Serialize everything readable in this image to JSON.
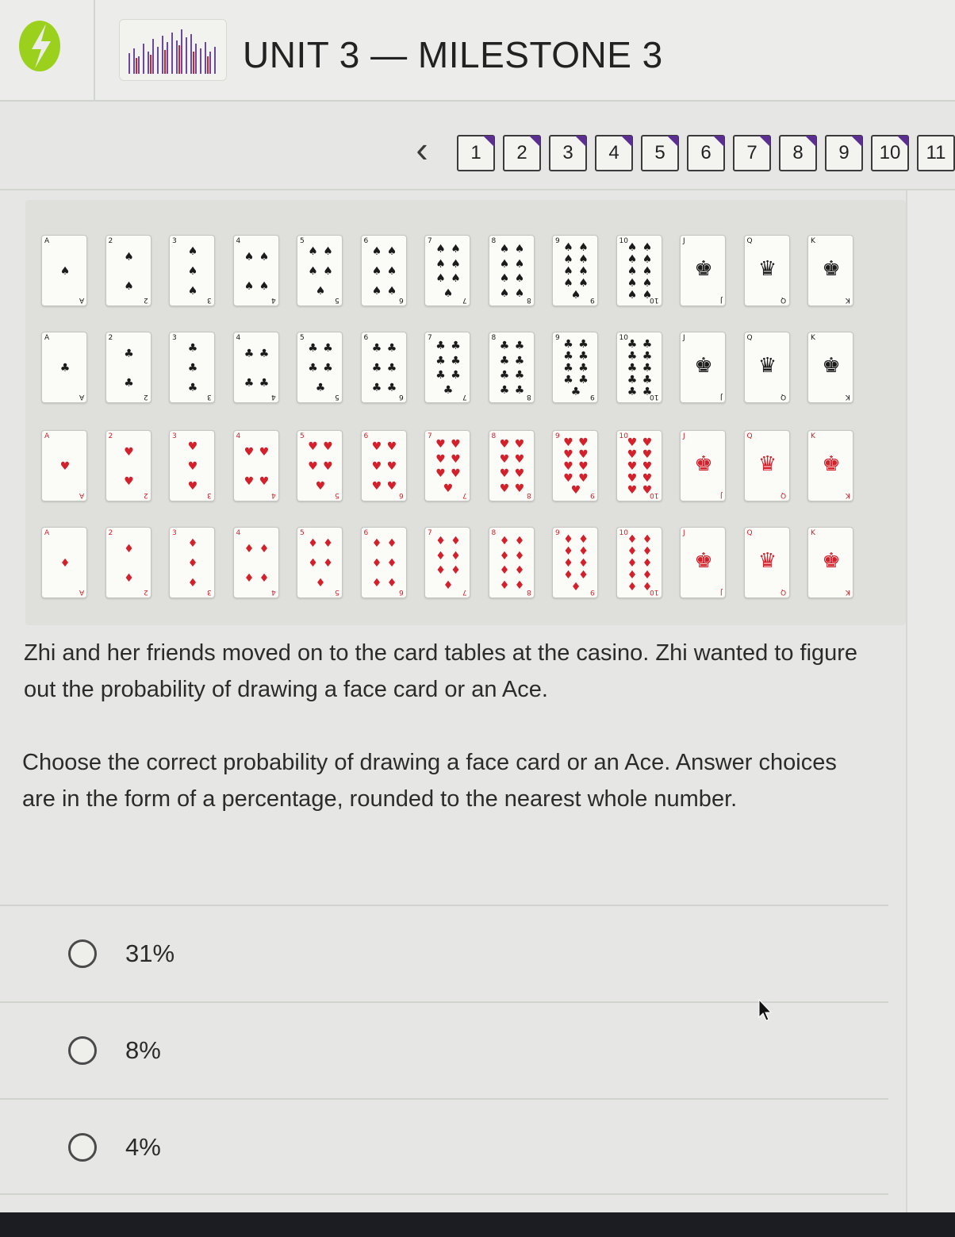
{
  "header": {
    "title": "UNIT 3 — MILESTONE 3",
    "logo_icon": "sophia-logo-icon",
    "accent": "#9bd11d"
  },
  "nav": {
    "prev_icon": "chevron-left-icon",
    "questions": [
      "1",
      "2",
      "3",
      "4",
      "5",
      "6",
      "7",
      "8",
      "9",
      "10",
      "11"
    ],
    "answered_flag_color": "#5a2f8f"
  },
  "deck": {
    "rows": [
      {
        "suit": "♠",
        "color": "black",
        "ranks": [
          "A",
          "2",
          "3",
          "4",
          "5",
          "6",
          "7",
          "8",
          "9",
          "10",
          "J",
          "Q",
          "K"
        ]
      },
      {
        "suit": "♣",
        "color": "black",
        "ranks": [
          "A",
          "2",
          "3",
          "4",
          "5",
          "6",
          "7",
          "8",
          "9",
          "10",
          "J",
          "Q",
          "K"
        ]
      },
      {
        "suit": "♥",
        "color": "red",
        "ranks": [
          "A",
          "2",
          "3",
          "4",
          "5",
          "6",
          "7",
          "8",
          "9",
          "10",
          "J",
          "Q",
          "K"
        ]
      },
      {
        "suit": "♦",
        "color": "red",
        "ranks": [
          "A",
          "2",
          "3",
          "4",
          "5",
          "6",
          "7",
          "8",
          "9",
          "10",
          "J",
          "Q",
          "K"
        ]
      }
    ]
  },
  "question": {
    "prompt": "Zhi and her friends moved on to the card tables at the casino. Zhi wanted to figure out the probability of drawing a face card or an Ace.",
    "instruction": "Choose the correct probability of drawing a face card or an Ace. Answer choices are in the form of a percentage, rounded to the nearest whole number."
  },
  "choices": [
    {
      "label": "31%"
    },
    {
      "label": "8%"
    },
    {
      "label": "4%"
    }
  ]
}
